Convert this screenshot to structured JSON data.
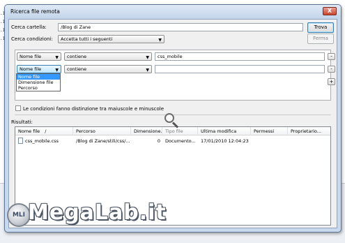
{
  "window": {
    "title": "Ricerca file remota",
    "close_label": "X"
  },
  "search": {
    "folder_label": "Cerca cartella:",
    "folder_value": "/Blog di Zane",
    "conditions_label": "Cerca condizioni:",
    "conditions_value": "Accetta tutti i seguenti",
    "find_button": "Trova",
    "stop_button": "Ferma"
  },
  "rules": [
    {
      "field": "Nome file",
      "operator": "contiene",
      "value": "css_mobile",
      "remove_label": "-"
    },
    {
      "field": "Nome file",
      "operator": "contiene",
      "value": "",
      "remove_label": "-"
    }
  ],
  "add_rule_label": "+",
  "field_dropdown": {
    "options": [
      "Nome file",
      "Dimensione file",
      "Percorso"
    ],
    "selected": "Nome file"
  },
  "case_sensitive_label": "Le condizioni fanno distinzione tra maiuscole e minuscole",
  "results": {
    "label": "Risultati:",
    "columns": [
      "Nome file",
      "Percorso",
      "Dimensione...",
      "Tipo file",
      "Ultima modifica",
      "Permessi",
      "Proprietario..."
    ],
    "sort_indicator": "/",
    "rows": [
      {
        "name": "css_mobile.css",
        "path": "/Blog di Zane/stili/css/...",
        "size": "0",
        "type": "Documento...",
        "modified": "17/01/2010 12:04:23",
        "permissions": "",
        "owner": ""
      }
    ]
  },
  "background": {
    "left_marks": [
      ".1",
      ".1",
      ".1",
      ".1"
    ]
  },
  "watermark": {
    "text": "MegaLab.it",
    "logo_text": "MLI"
  },
  "colors": {
    "accent": "#3399ff",
    "dialog_frame": "#c9d9ed",
    "close": "#c8452f"
  }
}
